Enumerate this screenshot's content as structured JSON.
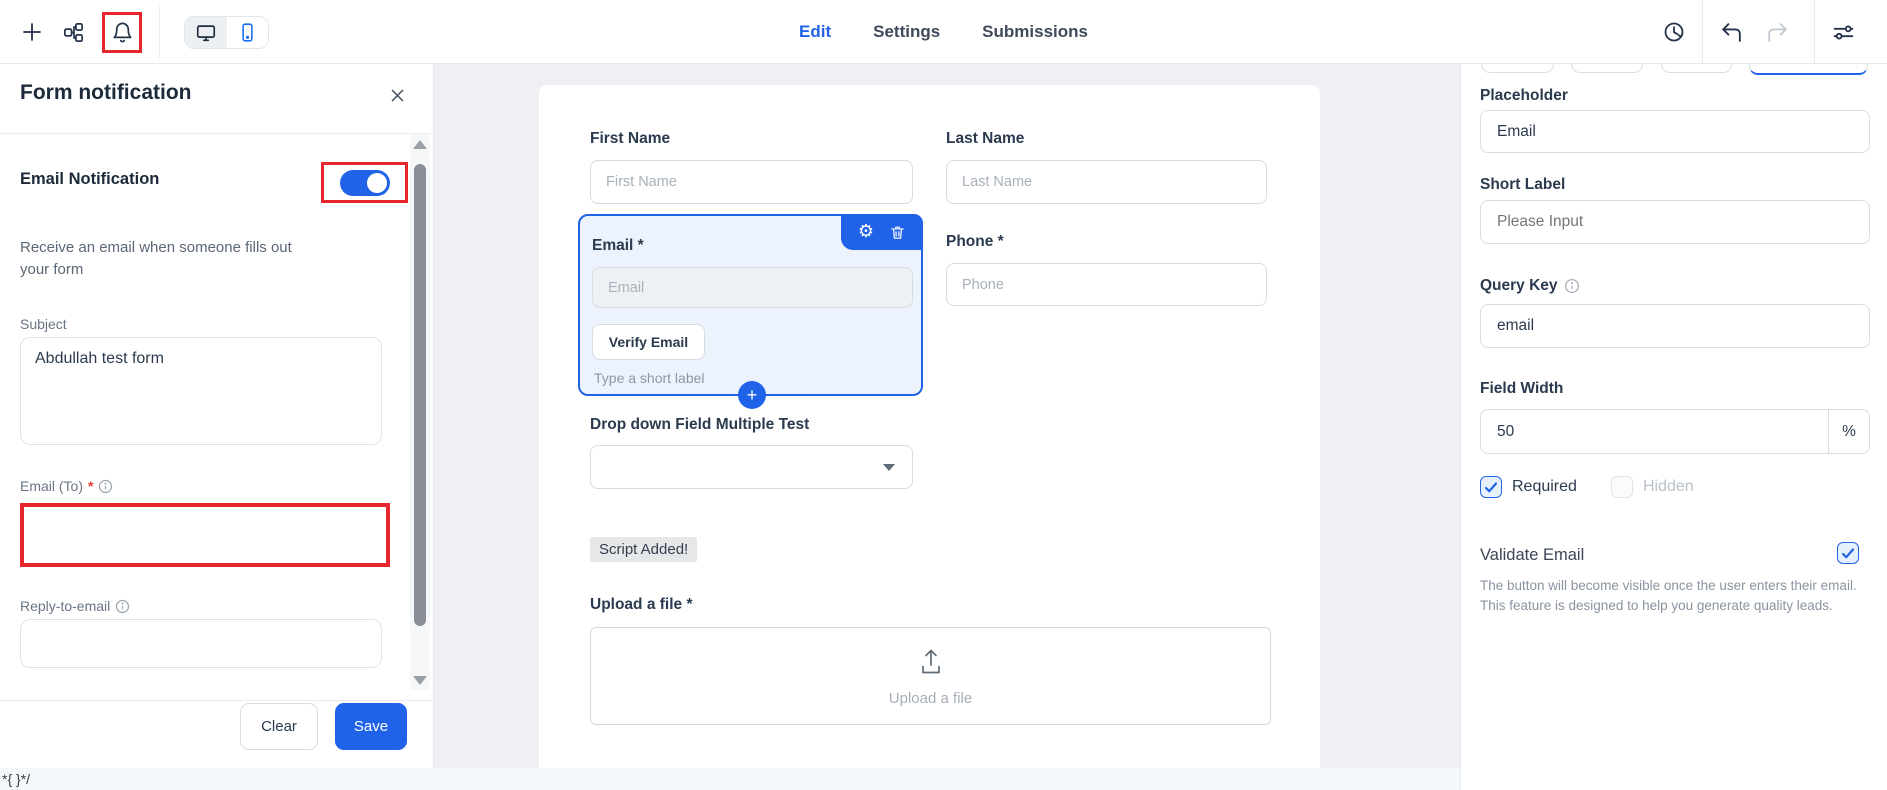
{
  "colors": {
    "accent": "#2163e8",
    "highlight_red": "#e8262d",
    "selected_field_bg": "#edf3fc"
  },
  "icons": {
    "gear_glyph": "⚙",
    "plus_glyph": "+"
  },
  "toolbar": {
    "nav": [
      {
        "label": "Edit"
      },
      {
        "label": "Settings"
      },
      {
        "label": "Submissions"
      }
    ],
    "active_nav": "Edit"
  },
  "notification_panel": {
    "title": "Form notification",
    "email_notification_label": "Email Notification",
    "email_notification_on": true,
    "description": "Receive an email when someone fills out your form",
    "subject_label": "Subject",
    "subject_value": "Abdullah test form",
    "email_to_label": "Email (To)",
    "required_mark": "*",
    "reply_to_label": "Reply-to-email",
    "clear_button": "Clear",
    "save_button": "Save"
  },
  "form_canvas": {
    "first_name": {
      "label": "First Name",
      "placeholder": "First Name"
    },
    "last_name": {
      "label": "Last Name",
      "placeholder": "Last Name"
    },
    "email": {
      "label": "Email *",
      "placeholder": "Email",
      "verify_button": "Verify Email",
      "helper": "Type a short label"
    },
    "phone": {
      "label": "Phone *",
      "placeholder": "Phone"
    },
    "dropdown": {
      "label": "Drop down Field Multiple Test"
    },
    "script_badge": "Script Added!",
    "upload": {
      "label": "Upload a file *",
      "placeholder": "Upload a file"
    }
  },
  "properties_panel": {
    "placeholder_field": {
      "label": "Placeholder",
      "value": "Email"
    },
    "short_label_field": {
      "label": "Short Label",
      "placeholder": "Please Input"
    },
    "query_key_field": {
      "label": "Query Key",
      "value": "email"
    },
    "field_width": {
      "label": "Field Width",
      "value": "50",
      "unit": "%"
    },
    "required_checkbox": {
      "label": "Required",
      "checked": true
    },
    "hidden_checkbox": {
      "label": "Hidden",
      "checked": false
    },
    "validate_email": {
      "label": "Validate Email",
      "checked": true,
      "description": "The button will become visible once the user enters their email. This feature is designed to help you generate quality leads."
    }
  },
  "footer_text": "*{ }*/"
}
